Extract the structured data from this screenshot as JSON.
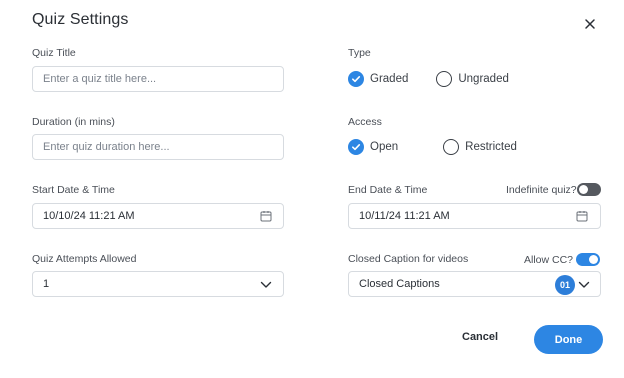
{
  "modal": {
    "title": "Quiz Settings",
    "close_icon": "close-icon"
  },
  "quiz_title": {
    "label": "Quiz Title",
    "placeholder": "Enter a quiz title here...",
    "value": ""
  },
  "type": {
    "label": "Type",
    "options": [
      {
        "label": "Graded",
        "checked": true
      },
      {
        "label": "Ungraded",
        "checked": false
      }
    ]
  },
  "duration": {
    "label": "Duration (in mins)",
    "placeholder": "Enter quiz duration here...",
    "value": ""
  },
  "access": {
    "label": "Access",
    "options": [
      {
        "label": "Open",
        "checked": true
      },
      {
        "label": "Restricted",
        "checked": false
      }
    ]
  },
  "start": {
    "label": "Start Date & Time",
    "value": "10/10/24 11:21 AM",
    "icon": "calendar-icon"
  },
  "end": {
    "label": "End Date & Time",
    "value": "10/11/24 11:21 AM",
    "icon": "calendar-icon",
    "indefinite_label": "Indefinite quiz?",
    "indefinite_on": false
  },
  "attempts": {
    "label": "Quiz Attempts Allowed",
    "value": "1",
    "icon": "chevron-down-icon"
  },
  "captions": {
    "label": "Closed Caption for videos",
    "allow_label": "Allow CC?",
    "allow_on": true,
    "value": "Closed Captions",
    "badge": "01",
    "icon": "chevron-down-icon"
  },
  "actions": {
    "cancel_label": "Cancel",
    "done_label": "Done"
  },
  "colors": {
    "accent": "#2d86e3",
    "toggle_off": "#55595f",
    "border": "#d7dbe0"
  }
}
